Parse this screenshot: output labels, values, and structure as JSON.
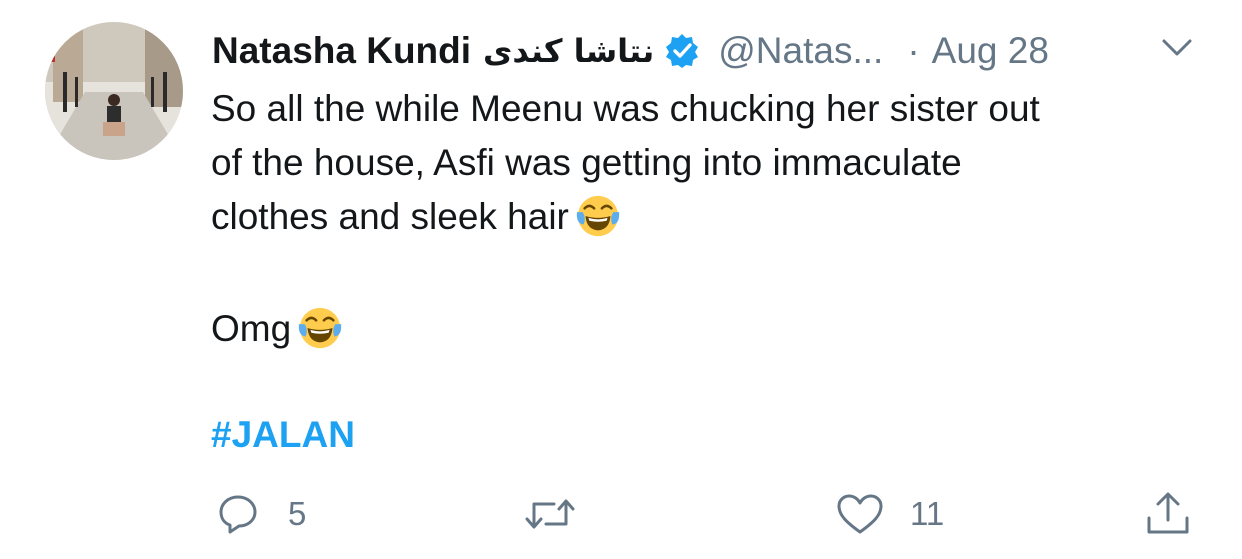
{
  "tweet": {
    "display_name": "Natasha Kundi",
    "urdu_name": "نتاشا کندی",
    "handle": "@Natas...",
    "dot": "·",
    "date": "Aug 28",
    "body_lines": [
      "So all the while Meenu was chucking her sister out",
      "of the house, Asfi was getting into immaculate",
      "clothes and sleek hair"
    ],
    "second_paragraph": "Omg",
    "hashtag": "#JALAN",
    "emoji_name": "face-with-tears-of-joy"
  },
  "actions": {
    "reply_count": "5",
    "retweet_count": "",
    "like_count": "11"
  },
  "colors": {
    "text": "#14171a",
    "secondary": "#657786",
    "accent": "#1da1f2"
  },
  "icons": {
    "reply": "reply-icon",
    "retweet": "retweet-icon",
    "like": "heart-icon",
    "share": "share-icon",
    "verified": "verified-badge-icon",
    "menu": "chevron-down-icon"
  }
}
